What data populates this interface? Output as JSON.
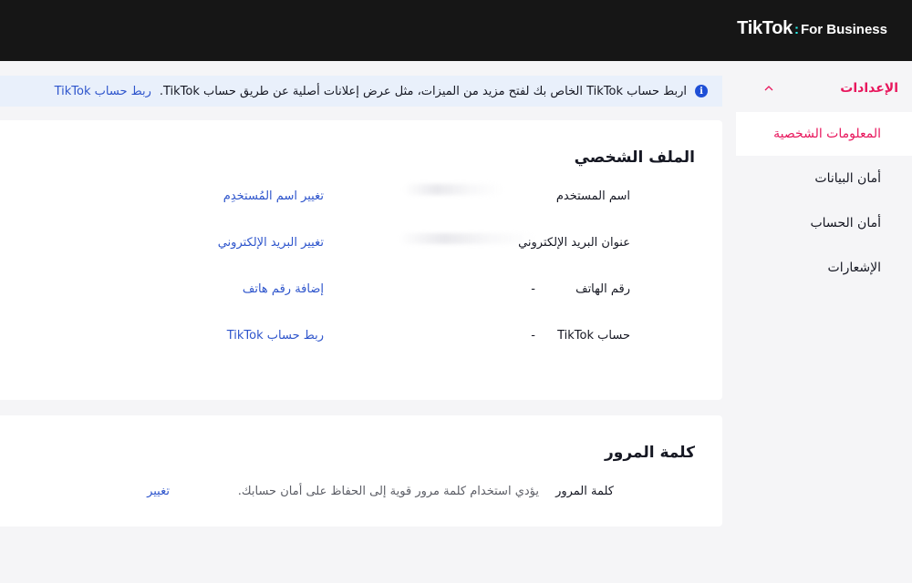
{
  "header": {
    "brand": "TikTok",
    "separator": ":",
    "product": "For Business"
  },
  "sidebar": {
    "section_label": "الإعدادات",
    "section_icon": "chevron-up-icon",
    "items": [
      {
        "label": "المعلومات الشخصية",
        "active": true
      },
      {
        "label": "أمان البيانات",
        "active": false
      },
      {
        "label": "أمان الحساب",
        "active": false
      },
      {
        "label": "الإشعارات",
        "active": false
      }
    ]
  },
  "banner": {
    "icon": "info-icon",
    "message": "اربط حساب TikTok الخاص بك لفتح مزيد من الميزات، مثل عرض إعلانات أصلية عن طريق حساب TikTok.",
    "link": "ربط حساب TikTok"
  },
  "profile": {
    "title": "الملف الشخصي",
    "rows": [
      {
        "label": "اسم المستخدم",
        "value": "",
        "action": "تغيير اسم المُستخدِم"
      },
      {
        "label": "عنوان البريد الإلكتروني",
        "value": "",
        "action": "تغيير البريد الإلكتروني"
      },
      {
        "label": "رقم الهاتف",
        "value": "-",
        "action": "إضافة رقم هاتف"
      },
      {
        "label": "حساب TikTok",
        "value": "-",
        "action": "ربط حساب TikTok"
      }
    ]
  },
  "password": {
    "title": "كلمة المرور",
    "label": "كلمة المرور",
    "description": "يؤدي استخدام كلمة مرور قوية إلى الحفاظ على أمان حسابك.",
    "action": "تغيير"
  },
  "colors": {
    "accent": "#e8175d",
    "link": "#2e55cc",
    "topbar": "#161616",
    "banner_bg": "#e9f0fb",
    "info_icon": "#1e4fd6"
  }
}
